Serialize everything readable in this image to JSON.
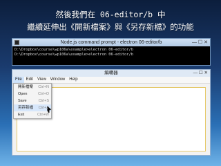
{
  "slide": {
    "line1": "然後我們在 06-editor/b 中",
    "line2": "繼續延伸出《開新檔案》與《另存新檔》的功能"
  },
  "console": {
    "title": "Node.js command prompt - electron 06-editor/b",
    "controls": "—  ☐  ✕",
    "lines": [
      "D:\\Dropbox\\course\\wp106a\\example>electron 06-editor/b",
      "",
      "D:\\Dropbox\\course\\wp106a\\example>electron 06-editor/b"
    ]
  },
  "app": {
    "title": "編輯器",
    "controls": "—  ☐  ✕",
    "menu": [
      "File",
      "Edit",
      "View",
      "Window",
      "Help"
    ],
    "file_menu": [
      {
        "label": "開新檔案",
        "shortcut": "Ctrl+N"
      },
      {
        "label": "Open",
        "shortcut": "Ctrl+O"
      },
      {
        "label": "Save",
        "shortcut": "Ctrl+S"
      },
      {
        "label": "另存新檔",
        "shortcut": "Ctrl+A"
      },
      {
        "label": "Exit",
        "shortcut": "Ctrl+W"
      }
    ]
  }
}
